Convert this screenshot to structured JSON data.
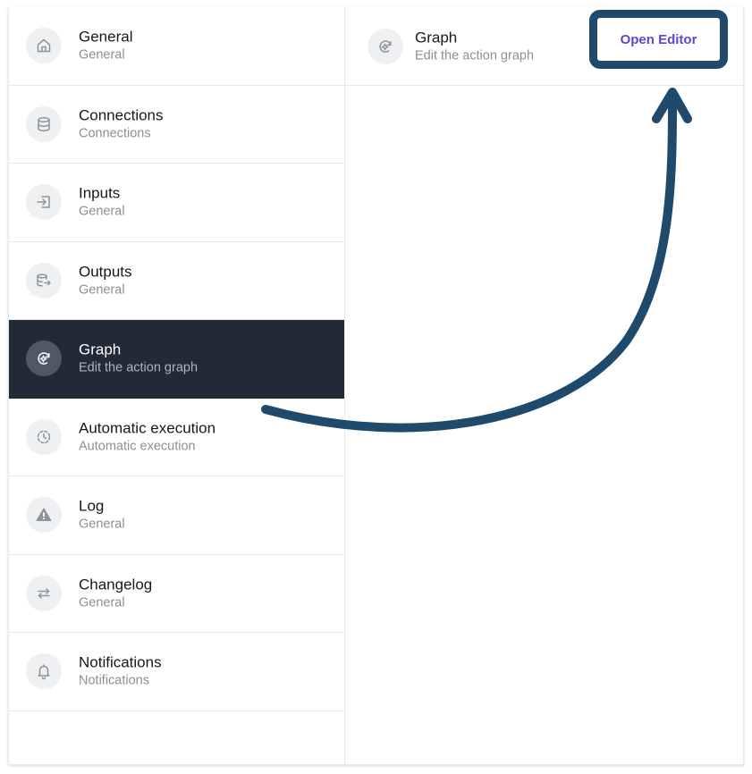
{
  "sidebar": {
    "items": [
      {
        "title": "General",
        "subtitle": "General",
        "icon": "home-icon"
      },
      {
        "title": "Connections",
        "subtitle": "Connections",
        "icon": "database-icon"
      },
      {
        "title": "Inputs",
        "subtitle": "General",
        "icon": "input-icon"
      },
      {
        "title": "Outputs",
        "subtitle": "General",
        "icon": "output-icon"
      },
      {
        "title": "Graph",
        "subtitle": "Edit the action graph",
        "icon": "graph-gear-icon",
        "active": true
      },
      {
        "title": "Automatic execution",
        "subtitle": "Automatic execution",
        "icon": "clock-dashed-icon"
      },
      {
        "title": "Log",
        "subtitle": "General",
        "icon": "warning-icon"
      },
      {
        "title": "Changelog",
        "subtitle": "General",
        "icon": "swap-arrows-icon"
      },
      {
        "title": "Notifications",
        "subtitle": "Notifications",
        "icon": "bell-icon"
      }
    ]
  },
  "panel": {
    "title": "Graph",
    "subtitle": "Edit the action graph",
    "icon": "graph-gear-icon",
    "open_editor_label": "Open Editor"
  },
  "colors": {
    "active_bg": "#222a38",
    "accent_text": "#5b46d6",
    "annotation": "#1f4a6c",
    "icon_bg": "#eef0f2",
    "icon_stroke": "#8e949c"
  }
}
